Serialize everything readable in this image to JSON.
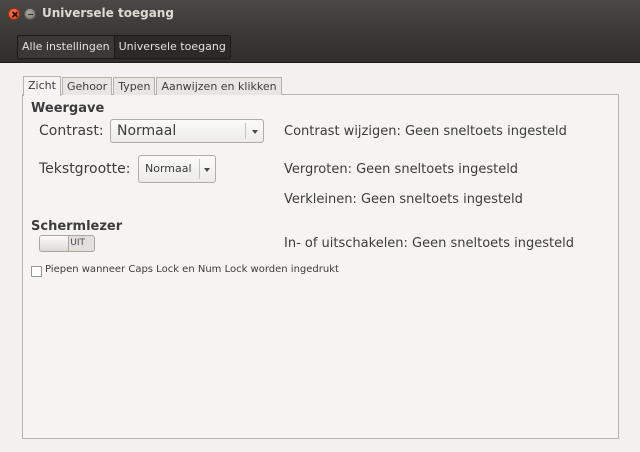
{
  "window": {
    "title": "Universele toegang"
  },
  "breadcrumb": [
    "Alle instellingen",
    "Universele toegang"
  ],
  "tabs": [
    "Zicht",
    "Gehoor",
    "Typen",
    "Aanwijzen en klikken"
  ],
  "weergave": {
    "title": "Weergave",
    "contrast_label": "Contrast:",
    "contrast_value": "Normaal",
    "textsize_label": "Tekstgrootte:",
    "textsize_value": "Normaal",
    "contrast_shortcut": "Contrast wijzigen: Geen sneltoets ingesteld",
    "zoom_in_shortcut": "Vergroten: Geen sneltoets ingesteld",
    "zoom_out_shortcut": "Verkleinen: Geen sneltoets ingesteld"
  },
  "schermlezer": {
    "title": "Schermlezer",
    "switch_state": "UIT",
    "toggle_shortcut": "In- of uitschakelen: Geen sneltoets ingesteld"
  },
  "caps_lock_beep": {
    "label": "Piepen wanneer Caps Lock en Num Lock worden ingedrukt",
    "checked": false
  },
  "icons": {
    "close": "close-icon",
    "minimize": "minimize-icon",
    "dropdown": "chevron-down-icon"
  },
  "colors": {
    "titlebar": "#3c3b37",
    "close_button": "#df4a16",
    "window_bg": "#f2f1f0"
  }
}
